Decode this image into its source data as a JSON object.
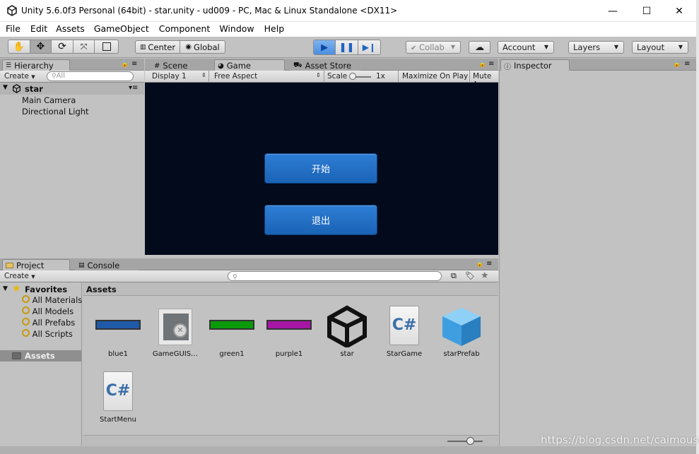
{
  "window": {
    "title": "Unity 5.6.0f3 Personal (64bit) - star.unity - ud009 - PC, Mac & Linux Standalone <DX11>",
    "minimize": "—",
    "maximize": "☐",
    "close": "✕"
  },
  "menu": [
    "File",
    "Edit",
    "Assets",
    "GameObject",
    "Component",
    "Window",
    "Help"
  ],
  "toolbar": {
    "pivot": "Center",
    "space": "Global",
    "collab": "Collab",
    "account": "Account",
    "layers": "Layers",
    "layout": "Layout",
    "play_color": "#2c77dc"
  },
  "hierarchy": {
    "tab": "Hierarchy",
    "create": "Create",
    "search_placeholder": "All",
    "scene": "star",
    "items": [
      "Main Camera",
      "Directional Light"
    ]
  },
  "center_tabs": [
    "Scene",
    "Game",
    "Asset Store"
  ],
  "game": {
    "display": "Display 1",
    "aspect": "Free Aspect",
    "scale_label": "Scale",
    "scale_value": "1x",
    "maximize": "Maximize On Play",
    "mute": "Mute A",
    "background": "#020a1c",
    "buttons": [
      "开始",
      "退出"
    ]
  },
  "inspector": {
    "tab": "Inspector"
  },
  "project": {
    "tabs": [
      "Project",
      "Console"
    ],
    "create": "Create",
    "favorites": {
      "label": "Favorites",
      "items": [
        "All Materials",
        "All Models",
        "All Prefabs",
        "All Scripts"
      ]
    },
    "assets_folder": "Assets",
    "breadcrumb": "Assets",
    "assets": [
      {
        "name": "blue1",
        "icon": "material-swatch-icon",
        "color": "#1f5aa8"
      },
      {
        "name": "GameGUIS…",
        "icon": "missing-asset-icon",
        "color": "#7a7a7a"
      },
      {
        "name": "green1",
        "icon": "material-swatch-icon",
        "color": "#0a9a0a"
      },
      {
        "name": "purple1",
        "icon": "material-swatch-icon",
        "color": "#a516a5"
      },
      {
        "name": "star",
        "icon": "unity-logo-icon",
        "color": "#111111"
      },
      {
        "name": "StarGame",
        "icon": "csharp-script-icon",
        "color": "#3b6fa8"
      },
      {
        "name": "starPrefab",
        "icon": "prefab-cube-icon",
        "color": "#4aa3e0"
      },
      {
        "name": "StartMenu",
        "icon": "csharp-script-icon",
        "color": "#3b6fa8"
      }
    ]
  },
  "watermark": "https://blog.csdn.net/caimouse"
}
